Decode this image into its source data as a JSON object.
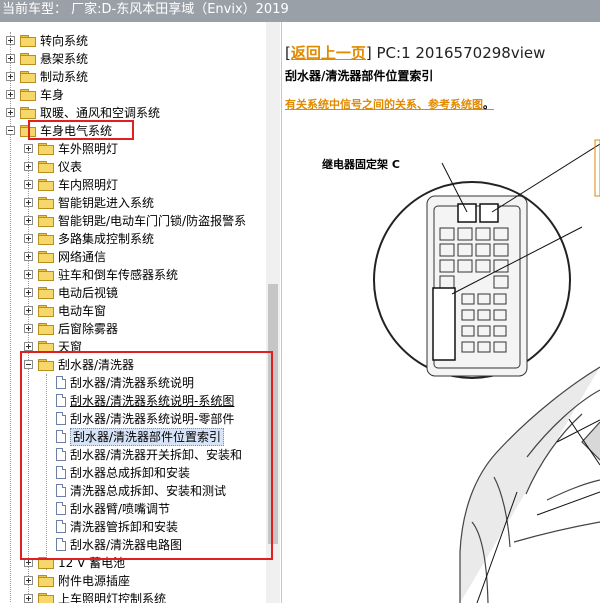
{
  "title_bar": "当前车型： 厂家:D-东风本田享域（Envix）2019",
  "tree": {
    "items": [
      {
        "label": "转向系统",
        "depth": 0,
        "type": "folder",
        "expander": "plus"
      },
      {
        "label": "悬架系统",
        "depth": 0,
        "type": "folder",
        "expander": "plus"
      },
      {
        "label": "制动系统",
        "depth": 0,
        "type": "folder",
        "expander": "plus"
      },
      {
        "label": "车身",
        "depth": 0,
        "type": "folder",
        "expander": "plus"
      },
      {
        "label": "取暖、通风和空调系统",
        "depth": 0,
        "type": "folder",
        "expander": "plus"
      },
      {
        "label": "车身电气系统",
        "depth": 0,
        "type": "folder",
        "expander": "minus"
      },
      {
        "label": "车外照明灯",
        "depth": 1,
        "type": "folder",
        "expander": "plus"
      },
      {
        "label": "仪表",
        "depth": 1,
        "type": "folder",
        "expander": "plus"
      },
      {
        "label": "车内照明灯",
        "depth": 1,
        "type": "folder",
        "expander": "plus"
      },
      {
        "label": "智能钥匙进入系统",
        "depth": 1,
        "type": "folder",
        "expander": "plus"
      },
      {
        "label": "智能钥匙/电动车门门锁/防盗报警系",
        "depth": 1,
        "type": "folder",
        "expander": "plus"
      },
      {
        "label": "多路集成控制系统",
        "depth": 1,
        "type": "folder",
        "expander": "plus"
      },
      {
        "label": "网络通信",
        "depth": 1,
        "type": "folder",
        "expander": "plus"
      },
      {
        "label": "驻车和倒车传感器系统",
        "depth": 1,
        "type": "folder",
        "expander": "plus"
      },
      {
        "label": "电动后视镜",
        "depth": 1,
        "type": "folder",
        "expander": "plus"
      },
      {
        "label": "电动车窗",
        "depth": 1,
        "type": "folder",
        "expander": "plus"
      },
      {
        "label": "后窗除雾器",
        "depth": 1,
        "type": "folder",
        "expander": "plus"
      },
      {
        "label": "天窗",
        "depth": 1,
        "type": "folder",
        "expander": "plus"
      },
      {
        "label": "刮水器/清洗器",
        "depth": 1,
        "type": "folder",
        "expander": "minus"
      },
      {
        "label": "刮水器/清洗器系统说明",
        "depth": 2,
        "type": "doc"
      },
      {
        "label": "刮水器/清洗器系统说明-系统图",
        "depth": 2,
        "type": "doc",
        "underline": true
      },
      {
        "label": "刮水器/清洗器系统说明-零部件",
        "depth": 2,
        "type": "doc"
      },
      {
        "label": "刮水器/清洗器部件位置索引",
        "depth": 2,
        "type": "doc",
        "selected": true
      },
      {
        "label": "刮水器/清洗器开关拆卸、安装和",
        "depth": 2,
        "type": "doc"
      },
      {
        "label": "刮水器总成拆卸和安装",
        "depth": 2,
        "type": "doc"
      },
      {
        "label": "清洗器总成拆卸、安装和测试",
        "depth": 2,
        "type": "doc"
      },
      {
        "label": "刮水器臂/喷嘴调节",
        "depth": 2,
        "type": "doc"
      },
      {
        "label": "清洗器管拆卸和安装",
        "depth": 2,
        "type": "doc"
      },
      {
        "label": "刮水器/清洗器电路图",
        "depth": 2,
        "type": "doc"
      },
      {
        "label": "12 V 蓄电池",
        "depth": 1,
        "type": "folder",
        "expander": "plus"
      },
      {
        "label": "附件电源插座",
        "depth": 1,
        "type": "folder",
        "expander": "plus"
      },
      {
        "label": "上车照明灯控制系统",
        "depth": 1,
        "type": "folder",
        "expander": "plus"
      }
    ]
  },
  "content": {
    "back_link": "返回上一页",
    "bracket_open": "[",
    "bracket_close": "]",
    "pc_info": " PC:1 2016570298view",
    "page_title": "刮水器/清洗器部件位置索引",
    "related_link": "有关系统中信号之间的关系、参考系统图",
    "related_period": "。",
    "callout_label": "继电器固定架 C"
  }
}
